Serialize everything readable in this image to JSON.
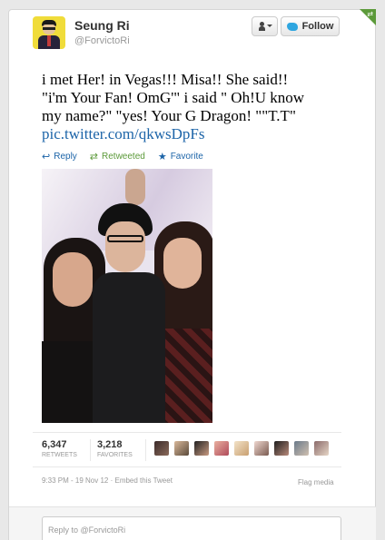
{
  "author": {
    "name": "Seung Ri",
    "handle": "@ForvictoRi"
  },
  "follow_button": {
    "label": "Follow"
  },
  "tweet": {
    "lines": [
      "i met Her! in Vegas!!! Misa!! She said!!",
      "\"i'm Your Fan! OmG'\" i said \" Oh!U know",
      "my name?\" \"yes! Your G Dragon! \"\"T.T\""
    ],
    "link": "pic.twitter.com/qkwsDpFs"
  },
  "actions": {
    "reply": "Reply",
    "retweeted": "Retweeted",
    "favorite": "Favorite"
  },
  "stats": {
    "retweets_count": "6,347",
    "retweets_label": "RETWEETS",
    "favorites_count": "3,218",
    "favorites_label": "FAVORITES"
  },
  "meta": {
    "timestamp": "9:33 PM - 19 Nov 12",
    "separator": " · ",
    "embed": "Embed this Tweet",
    "flag": "Flag media"
  },
  "reply_box": {
    "placeholder": "Reply to @ForvictoRi"
  },
  "icons": {
    "reply": "↩",
    "retweet": "⇄",
    "favorite": "★"
  },
  "colors": {
    "link": "#1c64a8",
    "retweeted": "#5c9a3a",
    "twitter_bird": "#2fa6e0"
  }
}
